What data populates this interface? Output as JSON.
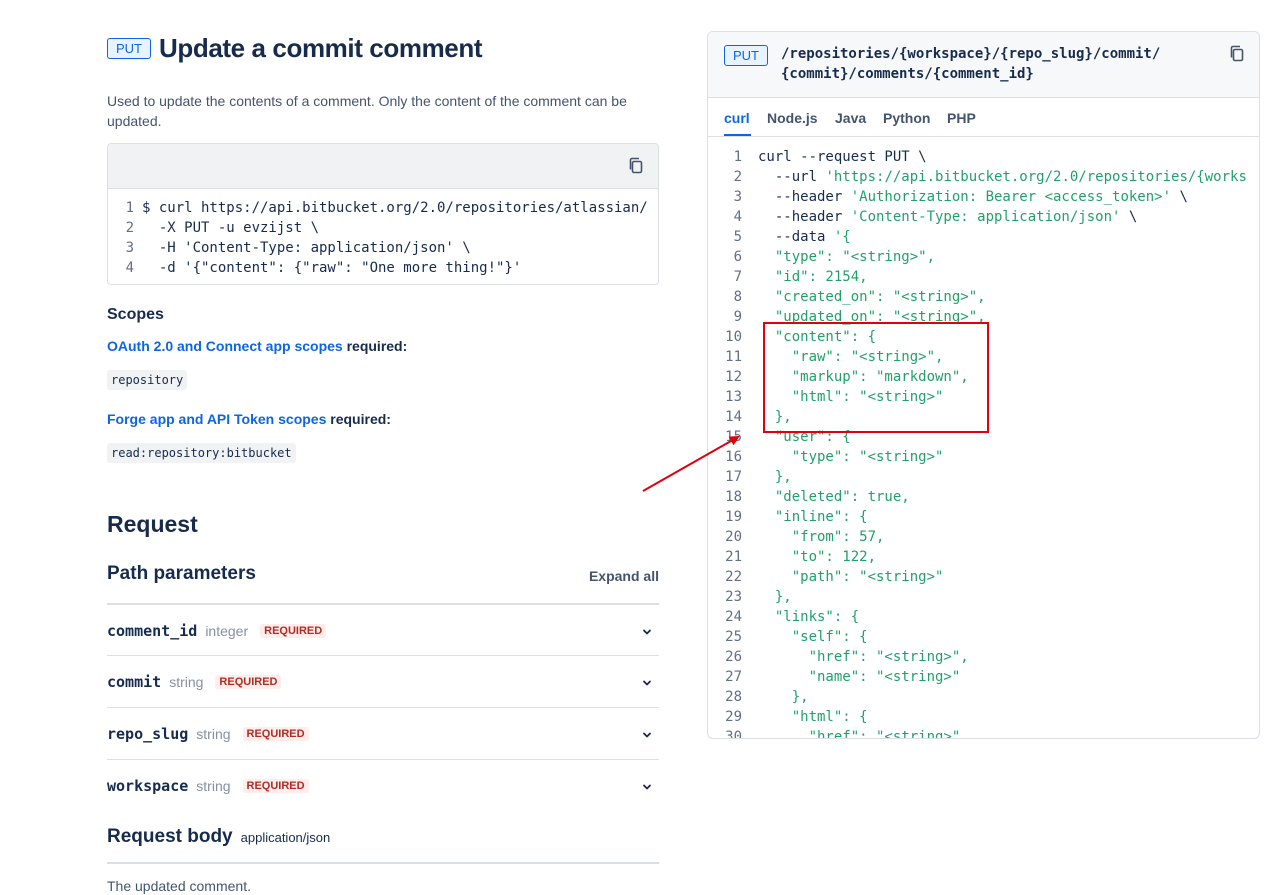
{
  "endpoint": {
    "method": "PUT",
    "title": "Update a commit comment",
    "description": "Used to update the contents of a comment. Only the content of the comment can be updated."
  },
  "example": {
    "lines": [
      {
        "n": "1",
        "text": "$ curl https://api.bitbucket.org/2.0/repositories/atlassian/"
      },
      {
        "n": "2",
        "text": "  -X PUT -u evzijst \\"
      },
      {
        "n": "3",
        "text": "  -H 'Content-Type: application/json' \\"
      },
      {
        "n": "4",
        "text": "  -d '{\"content\": {\"raw\": \"One more thing!\"}'"
      }
    ]
  },
  "scopes": {
    "heading": "Scopes",
    "oauth_link": "OAuth 2.0 and Connect app scopes",
    "oauth_suffix": " required:",
    "oauth_scope": "repository",
    "forge_link": "Forge app and API Token scopes",
    "forge_suffix": " required:",
    "forge_scope": "read:repository:bitbucket"
  },
  "request": {
    "heading": "Request",
    "path_params_heading": "Path parameters",
    "expand_all": "Expand all",
    "params": [
      {
        "name": "comment_id",
        "type": "integer",
        "required": "REQUIRED"
      },
      {
        "name": "commit",
        "type": "string",
        "required": "REQUIRED"
      },
      {
        "name": "repo_slug",
        "type": "string",
        "required": "REQUIRED"
      },
      {
        "name": "workspace",
        "type": "string",
        "required": "REQUIRED"
      }
    ],
    "body_heading": "Request body",
    "body_type": "application/json",
    "body_description": "The updated comment."
  },
  "panel": {
    "method": "PUT",
    "path_line1": "/repositories/{workspace}/{repo_slug}/commit/",
    "path_line2": "{commit}/comments/{comment_id}",
    "tabs": [
      "curl",
      "Node.js",
      "Java",
      "Python",
      "PHP"
    ],
    "active_tab": "curl",
    "code": [
      {
        "n": "1",
        "a": "curl --request PUT \\",
        "s": "",
        "b": ""
      },
      {
        "n": "2",
        "a": "  --url ",
        "s": "'https://api.bitbucket.org/2.0/repositories/{works",
        "b": ""
      },
      {
        "n": "3",
        "a": "  --header ",
        "s": "'Authorization: Bearer <access_token>'",
        "b": " \\"
      },
      {
        "n": "4",
        "a": "  --header ",
        "s": "'Content-Type: application/json'",
        "b": " \\"
      },
      {
        "n": "5",
        "a": "  --data ",
        "s": "'{",
        "b": ""
      },
      {
        "n": "6",
        "a": "",
        "s": "  \"type\": \"<string>\",",
        "b": ""
      },
      {
        "n": "7",
        "a": "",
        "s": "  \"id\": 2154,",
        "b": ""
      },
      {
        "n": "8",
        "a": "",
        "s": "  \"created_on\": \"<string>\",",
        "b": ""
      },
      {
        "n": "9",
        "a": "",
        "s": "  \"updated_on\": \"<string>\",",
        "b": ""
      },
      {
        "n": "10",
        "a": "",
        "s": "  \"content\": {",
        "b": ""
      },
      {
        "n": "11",
        "a": "",
        "s": "    \"raw\": \"<string>\",",
        "b": ""
      },
      {
        "n": "12",
        "a": "",
        "s": "    \"markup\": \"markdown\",",
        "b": ""
      },
      {
        "n": "13",
        "a": "",
        "s": "    \"html\": \"<string>\"",
        "b": ""
      },
      {
        "n": "14",
        "a": "",
        "s": "  },",
        "b": ""
      },
      {
        "n": "15",
        "a": "",
        "s": "  \"user\": {",
        "b": ""
      },
      {
        "n": "16",
        "a": "",
        "s": "    \"type\": \"<string>\"",
        "b": ""
      },
      {
        "n": "17",
        "a": "",
        "s": "  },",
        "b": ""
      },
      {
        "n": "18",
        "a": "",
        "s": "  \"deleted\": true,",
        "b": ""
      },
      {
        "n": "19",
        "a": "",
        "s": "  \"inline\": {",
        "b": ""
      },
      {
        "n": "20",
        "a": "",
        "s": "    \"from\": 57,",
        "b": ""
      },
      {
        "n": "21",
        "a": "",
        "s": "    \"to\": 122,",
        "b": ""
      },
      {
        "n": "22",
        "a": "",
        "s": "    \"path\": \"<string>\"",
        "b": ""
      },
      {
        "n": "23",
        "a": "",
        "s": "  },",
        "b": ""
      },
      {
        "n": "24",
        "a": "",
        "s": "  \"links\": {",
        "b": ""
      },
      {
        "n": "25",
        "a": "",
        "s": "    \"self\": {",
        "b": ""
      },
      {
        "n": "26",
        "a": "",
        "s": "      \"href\": \"<string>\",",
        "b": ""
      },
      {
        "n": "27",
        "a": "",
        "s": "      \"name\": \"<string>\"",
        "b": ""
      },
      {
        "n": "28",
        "a": "",
        "s": "    },",
        "b": ""
      },
      {
        "n": "29",
        "a": "",
        "s": "    \"html\": {",
        "b": ""
      },
      {
        "n": "30",
        "a": "",
        "s": "      \"href\": \"<string>\",",
        "b": ""
      }
    ]
  },
  "colors": {
    "accent": "#0c66e4",
    "string": "#22a06b",
    "required": "#ae2e24",
    "annotation": "#e2000f"
  },
  "icons": [
    "copy-icon",
    "chevron-down-icon"
  ]
}
